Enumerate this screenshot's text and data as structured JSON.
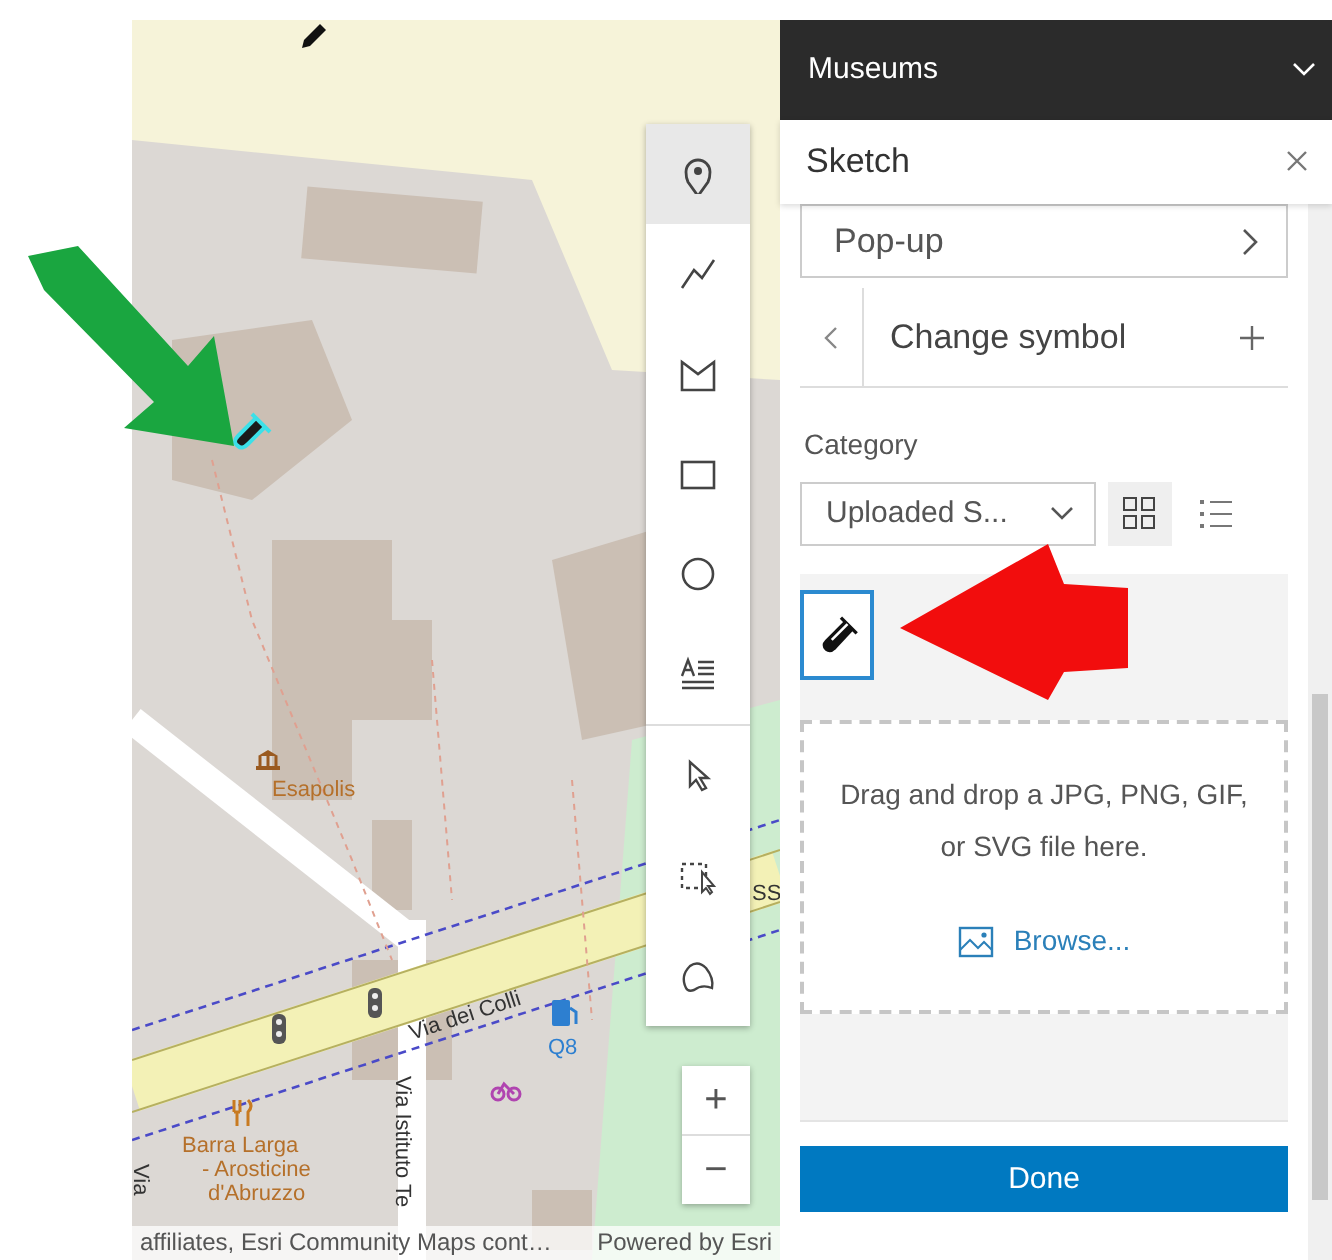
{
  "map": {
    "labels": [
      {
        "kind": "poi",
        "text": "Esapolis"
      },
      {
        "kind": "road",
        "text": "Via dei Colli"
      },
      {
        "kind": "road-vertical",
        "text": "Via Istituto Te"
      },
      {
        "kind": "poi",
        "text": "Barra Larga"
      },
      {
        "kind": "poi",
        "text": "- Arosticine"
      },
      {
        "kind": "poi",
        "text": "d'Abruzzo"
      },
      {
        "kind": "fuel",
        "text": "Q8"
      },
      {
        "kind": "shield",
        "text": "SS"
      },
      {
        "kind": "road-vertical",
        "text": "Via"
      }
    ],
    "attribution": "affiliates, Esri Community Maps cont…",
    "powered_by": "Powered by Esri",
    "zoom": {
      "in": "+",
      "out": "−"
    }
  },
  "toolbar": {
    "draw_tools": [
      {
        "kind": "point",
        "selected": true
      },
      {
        "kind": "polyline",
        "selected": false
      },
      {
        "kind": "polygon",
        "selected": false
      },
      {
        "kind": "rectangle",
        "selected": false
      },
      {
        "kind": "circle",
        "selected": false
      },
      {
        "kind": "text",
        "selected": false
      }
    ],
    "select_tools": [
      {
        "kind": "select",
        "selected": false
      },
      {
        "kind": "rectangle-select",
        "selected": false
      },
      {
        "kind": "lasso",
        "selected": false
      }
    ]
  },
  "panel": {
    "layer_title": "Museums",
    "title": "Sketch",
    "popup_row": "Pop-up",
    "section_title": "Change symbol",
    "category_label": "Category",
    "category_value": "Uploaded S...",
    "views": [
      {
        "kind": "grid",
        "selected": true
      },
      {
        "kind": "list",
        "selected": false
      }
    ],
    "symbols": [
      {
        "selected": true
      }
    ],
    "drop_text": "Drag and drop a JPG, PNG, GIF, or SVG file here.",
    "browse": "Browse...",
    "done": "Done"
  },
  "annotations": [
    {
      "kind": "arrow-down-right",
      "color": "#1aa640"
    },
    {
      "kind": "arrow-left",
      "color": "#f20d0d"
    }
  ]
}
